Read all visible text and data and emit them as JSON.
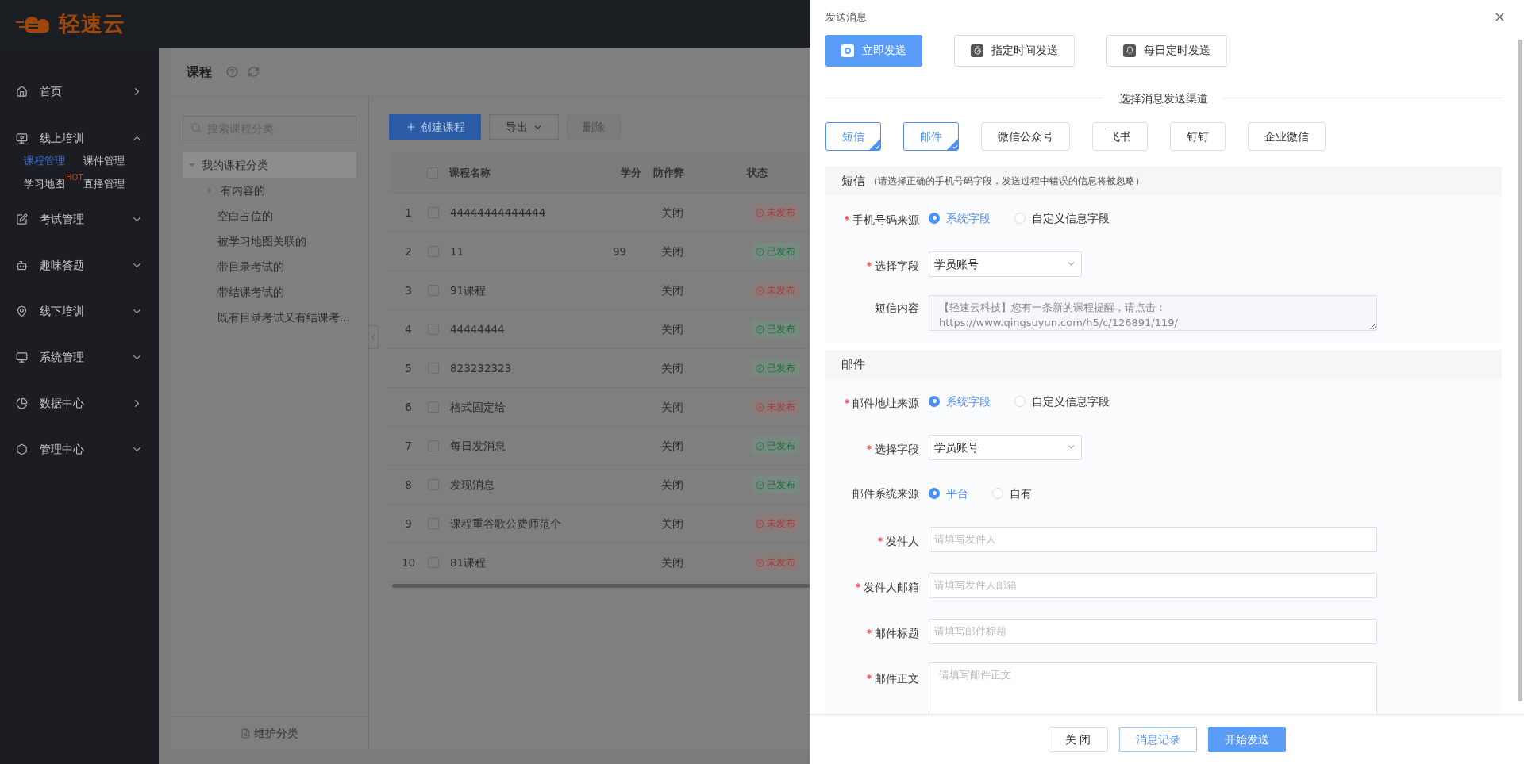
{
  "brand": {
    "name": "轻速云"
  },
  "sidebar": {
    "items": [
      {
        "label": "首页",
        "kind": "link"
      },
      {
        "label": "线上培训",
        "kind": "group",
        "expanded": true,
        "children": [
          {
            "label": "课程管理",
            "selected": true
          },
          {
            "label": "课件管理",
            "selected": false
          },
          {
            "label": "学习地图",
            "selected": false,
            "badge": "HOT"
          },
          {
            "label": "直播管理",
            "selected": false
          }
        ]
      },
      {
        "label": "考试管理",
        "kind": "group",
        "expanded": false
      },
      {
        "label": "趣味答题",
        "kind": "group",
        "expanded": false
      },
      {
        "label": "线下培训",
        "kind": "group",
        "expanded": false
      },
      {
        "label": "系统管理",
        "kind": "group",
        "expanded": false
      },
      {
        "label": "数据中心",
        "kind": "link"
      },
      {
        "label": "管理中心",
        "kind": "group",
        "expanded": false
      }
    ]
  },
  "page": {
    "title": "课程"
  },
  "categories": {
    "search": {
      "placeholder": "搜索课程分类"
    },
    "tree": [
      {
        "label": "我的课程分类",
        "expanded": true,
        "selected": true,
        "children": [
          {
            "label": "有内容的",
            "expanded": false,
            "selected": false
          },
          {
            "label": "空白占位的",
            "selected": false
          },
          {
            "label": "被学习地图关联的",
            "selected": false
          },
          {
            "label": "带目录考试的",
            "selected": false
          },
          {
            "label": "带结课考试的",
            "selected": false
          },
          {
            "label": "既有目录考试又有结课考...",
            "selected": false
          }
        ]
      }
    ],
    "footer": "维护分类"
  },
  "toolbar": {
    "create": "创建课程",
    "export": "导出",
    "delete": {
      "label": "删除",
      "disabled": true
    }
  },
  "table": {
    "header_checked": false,
    "columns": [
      "课程名称",
      "学分",
      "防作弊",
      "状态"
    ],
    "rows": [
      {
        "index": "1",
        "checked": false,
        "name": "44444444444444",
        "credit": "",
        "anti_cheat": "关闭",
        "status": {
          "label": "未发布",
          "published": false
        }
      },
      {
        "index": "2",
        "checked": false,
        "name": "11",
        "credit": "99",
        "anti_cheat": "关闭",
        "status": {
          "label": "已发布",
          "published": true
        }
      },
      {
        "index": "3",
        "checked": false,
        "name": "91课程",
        "credit": "",
        "anti_cheat": "关闭",
        "status": {
          "label": "未发布",
          "published": false
        }
      },
      {
        "index": "4",
        "checked": false,
        "name": "44444444",
        "credit": "",
        "anti_cheat": "关闭",
        "status": {
          "label": "已发布",
          "published": true
        }
      },
      {
        "index": "5",
        "checked": false,
        "name": "823232323",
        "credit": "",
        "anti_cheat": "关闭",
        "status": {
          "label": "已发布",
          "published": true
        }
      },
      {
        "index": "6",
        "checked": false,
        "name": "格式固定给",
        "credit": "",
        "anti_cheat": "关闭",
        "status": {
          "label": "未发布",
          "published": false
        }
      },
      {
        "index": "7",
        "checked": false,
        "name": "每日发消息",
        "credit": "",
        "anti_cheat": "关闭",
        "status": {
          "label": "已发布",
          "published": true
        }
      },
      {
        "index": "8",
        "checked": false,
        "name": "发现消息",
        "credit": "",
        "anti_cheat": "关闭",
        "status": {
          "label": "已发布",
          "published": true
        }
      },
      {
        "index": "9",
        "checked": false,
        "name": "课程重谷歌公费师范个",
        "credit": "",
        "anti_cheat": "关闭",
        "status": {
          "label": "未发布",
          "published": false
        }
      },
      {
        "index": "10",
        "checked": false,
        "name": "81课程",
        "credit": "",
        "anti_cheat": "关闭",
        "status": {
          "label": "未发布",
          "published": false
        }
      }
    ]
  },
  "drawer": {
    "title": "发送消息",
    "send_modes": [
      {
        "label": "立即发送",
        "selected": true
      },
      {
        "label": "指定时间发送",
        "selected": false
      },
      {
        "label": "每日定时发送",
        "selected": false
      }
    ],
    "channel_heading": "选择消息发送渠道",
    "channels": [
      {
        "label": "短信",
        "selected": true
      },
      {
        "label": "邮件",
        "selected": true
      },
      {
        "label": "微信公众号",
        "selected": false
      },
      {
        "label": "飞书",
        "selected": false
      },
      {
        "label": "钉钉",
        "selected": false
      },
      {
        "label": "企业微信",
        "selected": false
      }
    ],
    "sections": [
      {
        "title": "短信",
        "note": "（请选择正确的手机号码字段，发送过程中错误的信息将被忽略）",
        "fields": [
          {
            "kind": "radio",
            "label": "手机号码来源",
            "required": true,
            "options": [
              {
                "label": "系统字段",
                "selected": true
              },
              {
                "label": "自定义信息字段",
                "selected": false
              }
            ]
          },
          {
            "kind": "select",
            "label": "选择字段",
            "required": true,
            "value": "学员账号"
          },
          {
            "kind": "textarea",
            "label": "短信内容",
            "required": false,
            "disabled": true,
            "value": "【轻速云科技】您有一条新的课程提醒，请点击：https://www.qingsuyun.com/h5/c/126891/119/"
          }
        ]
      },
      {
        "title": "邮件",
        "fields": [
          {
            "kind": "radio",
            "label": "邮件地址来源",
            "required": true,
            "options": [
              {
                "label": "系统字段",
                "selected": true
              },
              {
                "label": "自定义信息字段",
                "selected": false
              }
            ]
          },
          {
            "kind": "select",
            "label": "选择字段",
            "required": true,
            "value": "学员账号"
          },
          {
            "kind": "radio",
            "label": "邮件系统来源",
            "required": false,
            "options": [
              {
                "label": "平台",
                "selected": true
              },
              {
                "label": "自有",
                "selected": false
              }
            ]
          },
          {
            "kind": "input",
            "label": "发件人",
            "required": true,
            "placeholder": "请填写发件人"
          },
          {
            "kind": "input",
            "label": "发件人邮箱",
            "required": true,
            "placeholder": "请填写发件人邮箱"
          },
          {
            "kind": "input",
            "label": "邮件标题",
            "required": true,
            "placeholder": "请填写邮件标题"
          },
          {
            "kind": "textarea",
            "label": "邮件正文",
            "required": true,
            "disabled": false,
            "placeholder": "请填写邮件正文"
          }
        ]
      }
    ],
    "buttons": [
      {
        "label": "关 闭",
        "kind": "default"
      },
      {
        "label": "消息记录",
        "kind": "outline"
      },
      {
        "label": "开始发送",
        "kind": "primary"
      }
    ]
  }
}
